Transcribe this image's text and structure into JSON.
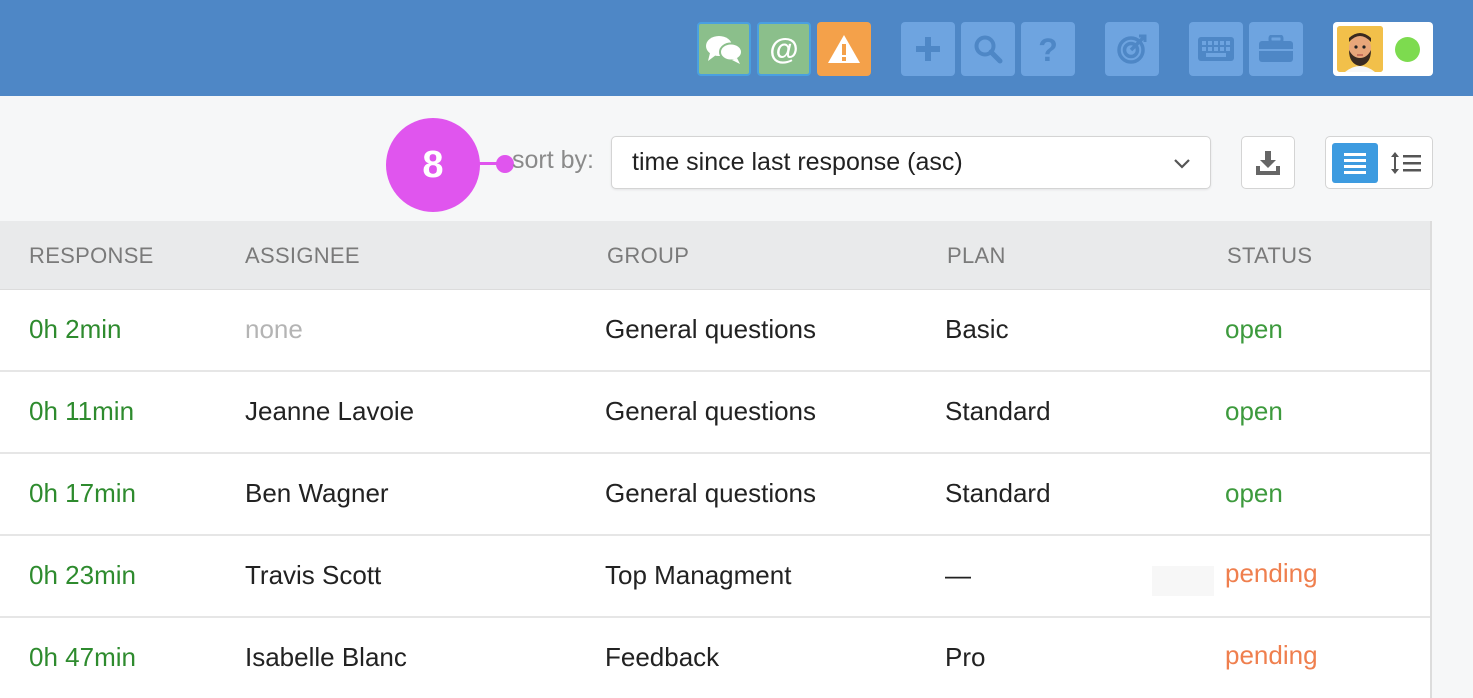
{
  "step_badge": "8",
  "sort": {
    "label": "sort by:",
    "value": "time since last response (asc)"
  },
  "columns": [
    "RESPONSE",
    "ASSIGNEE",
    "GROUP",
    "PLAN",
    "STATUS"
  ],
  "rows": [
    {
      "response": "0h 2min",
      "assignee": "none",
      "group": "General questions",
      "plan": "Basic",
      "status": "open"
    },
    {
      "response": "0h 11min",
      "assignee": "Jeanne Lavoie",
      "group": "General questions",
      "plan": "Standard",
      "status": "open"
    },
    {
      "response": "0h 17min",
      "assignee": "Ben Wagner",
      "group": "General questions",
      "plan": "Standard",
      "status": "open"
    },
    {
      "response": "0h 23min",
      "assignee": "Travis Scott",
      "group": "Top Managment",
      "plan": "—",
      "status": "pending"
    },
    {
      "response": "0h 47min",
      "assignee": "Isabelle Blanc",
      "group": "Feedback",
      "plan": "Pro",
      "status": "pending"
    }
  ],
  "icons": {
    "toolbar": [
      "chat-bubbles-icon",
      "at-sign-icon",
      "warning-icon",
      "plus-icon",
      "search-icon",
      "help-icon",
      "target-icon",
      "keyboard-icon",
      "briefcase-icon"
    ],
    "user": [
      "avatar",
      "online-status-dot"
    ],
    "controls": [
      "chevron-down-icon",
      "download-icon",
      "list-view-icon",
      "sort-lines-icon"
    ]
  },
  "colors": {
    "topbar": "#4e87c6",
    "badge": "#e055ee",
    "status_open": "#3d9a3d",
    "status_pending": "#ef7f4e",
    "response": "#2e8b2e",
    "online": "#7ddb4f"
  }
}
